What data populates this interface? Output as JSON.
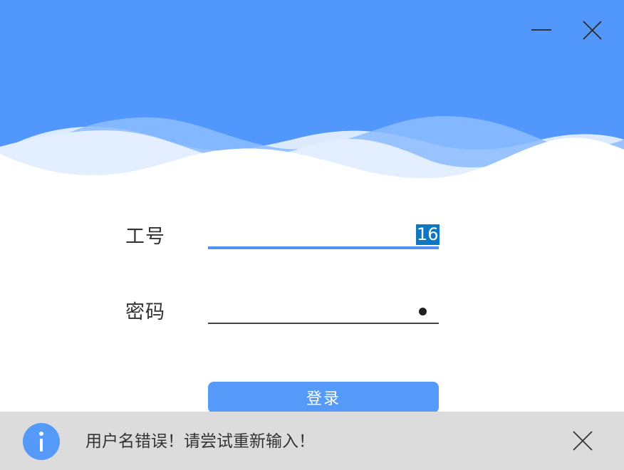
{
  "window": {
    "controls": {
      "minimize_icon": "minimize-icon",
      "close_icon": "close-icon"
    }
  },
  "form": {
    "employee_id": {
      "label": "工号",
      "value": "16"
    },
    "password": {
      "label": "密码",
      "masked_value": "•"
    },
    "login_button": "登录"
  },
  "notification": {
    "icon": "info-icon",
    "message": "用户名错误！请尝试重新输入！",
    "close_icon": "close-icon"
  },
  "colors": {
    "header_blue": "#5297fb",
    "accent": "#559af8",
    "selection": "#0f76c0",
    "notification_bg": "#dcdcdc",
    "wave_light": "#e3efff",
    "wave_mid": "#8cbcff"
  }
}
